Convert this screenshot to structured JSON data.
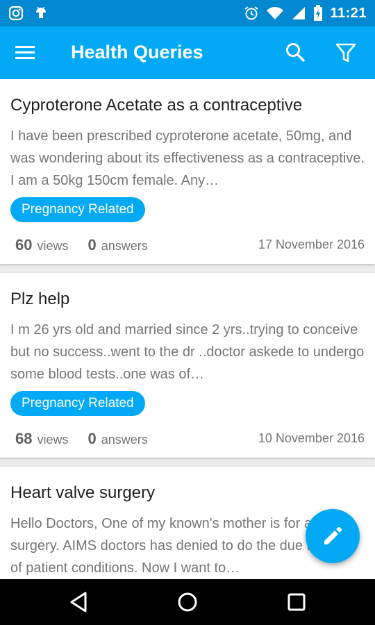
{
  "status_bar": {
    "time": "11:21",
    "left_icons": [
      "instagram-icon",
      "android-icon"
    ],
    "right_icons": [
      "alarm-icon",
      "wifi-icon",
      "signal-icon",
      "battery-icon"
    ]
  },
  "app_bar": {
    "title": "Health Queries",
    "actions": [
      "menu-icon",
      "search-icon",
      "filter-icon"
    ]
  },
  "queries": [
    {
      "title": "Cyproterone Acetate as a contraceptive",
      "excerpt": "I have been prescribed cyproterone acetate, 50mg, and was wondering about its effectiveness as a contraceptive. I am a 50kg 150cm female. Any…",
      "tag": "Pregnancy Related",
      "views": "60",
      "views_label": "views",
      "answers": "0",
      "answers_label": "answers",
      "date": "17 November 2016"
    },
    {
      "title": "Plz help",
      "excerpt": "I m 26 yrs old and married since 2 yrs..trying to conceive but no success..went to the dr ..doctor askede to undergo some blood tests..one was of…",
      "tag": "Pregnancy Related",
      "views": "68",
      "views_label": "views",
      "answers": "0",
      "answers_label": "answers",
      "date": "10 November 2016"
    },
    {
      "title": "Heart valve surgery",
      "excerpt": "Hello Doctors, One of my known's mother is for a heart surgery. AIMS doctors has denied to do the due to some of patient conditions. Now I want to…"
    }
  ],
  "fab": {
    "icon": "edit-pencil-icon"
  },
  "nav_bar": {
    "buttons": [
      "back-icon",
      "home-icon",
      "recents-icon"
    ]
  },
  "colors": {
    "primary": "#03a9f4",
    "primary_dark": "#0288d1",
    "text_primary": "#212121",
    "text_secondary": "#757575"
  }
}
